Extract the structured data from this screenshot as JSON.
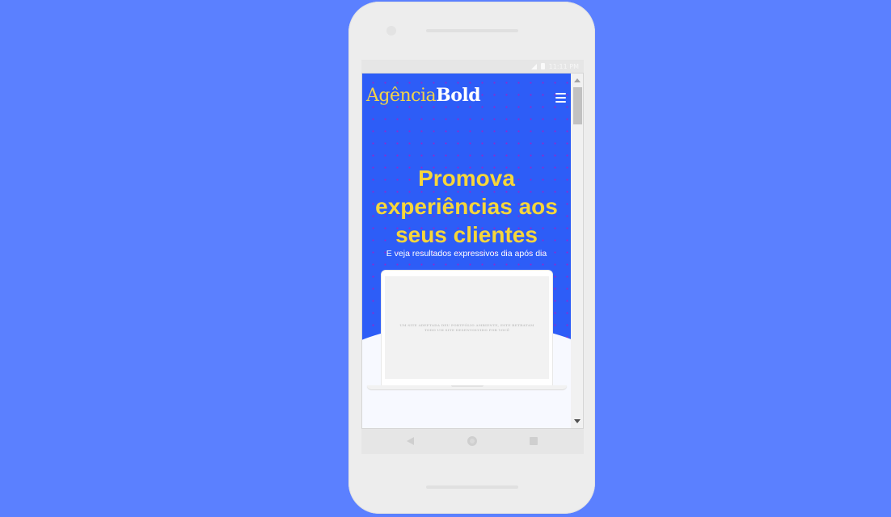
{
  "status_bar": {
    "time": "11:11 PM"
  },
  "header": {
    "logo_light": "Agência",
    "logo_bold": "Bold"
  },
  "hero": {
    "headline_line1": "Promova",
    "headline_line2": "experiências aos",
    "headline_line3": "seus clientes",
    "subline": "E veja resultados expressivos dia após dia"
  },
  "laptop": {
    "screen_text": "UM SITE ADEPTADA DEU PORTFÓLIO AMBIENTE, ESTE RETRATAM TODO UM SITE DESENVOLVIDO POR VOCÊ"
  },
  "colors": {
    "page_background": "#5b80ff",
    "hero_background": "#2d5df7",
    "accent_yellow": "#f6d63b",
    "dot_pattern": "#8a2bd1"
  },
  "icons": {
    "menu": "hamburger-menu-icon",
    "back": "back-triangle-icon",
    "home": "home-circle-icon",
    "recent": "recent-apps-square-icon"
  }
}
